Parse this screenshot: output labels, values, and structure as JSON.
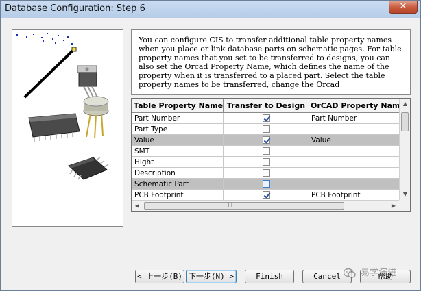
{
  "window": {
    "title": "Database Configuration: Step 6",
    "close_glyph": "✕"
  },
  "description": "You can configure CIS to transfer additional table property names when you place or link database parts on schematic pages. For table property names that you set to be transferred to designs, you can also set the Orcad Property Name, which defines the name of the property when it is transferred to a placed part. Select the table property names to be transferred, change the Orcad",
  "grid": {
    "headers": [
      "Table Property Name",
      "Transfer to Design",
      "OrCAD Property Name"
    ],
    "rows": [
      {
        "name": "Part Number",
        "transfer": true,
        "orcad": "Part Number",
        "shaded": false
      },
      {
        "name": "Part Type",
        "transfer": false,
        "orcad": "",
        "shaded": false
      },
      {
        "name": "Value",
        "transfer": true,
        "orcad": "Value",
        "shaded": true
      },
      {
        "name": "SMT",
        "transfer": false,
        "orcad": "",
        "shaded": false
      },
      {
        "name": "Hight",
        "transfer": false,
        "orcad": "",
        "shaded": false
      },
      {
        "name": "Description",
        "transfer": false,
        "orcad": "",
        "shaded": false
      },
      {
        "name": "Schematic Part",
        "transfer": false,
        "orcad": "",
        "shaded": true,
        "focused": true
      },
      {
        "name": "PCB Footprint",
        "transfer": true,
        "orcad": "PCB Footprint",
        "shaded": false
      }
    ]
  },
  "buttons": {
    "back": "< 上一步(B)",
    "next": "下一步(N) >",
    "finish": "Finish",
    "cancel": "Cancel",
    "help": "帮助"
  },
  "watermark": "易学演进",
  "icons": {
    "close": "close-icon",
    "scroll_up": "scroll-up-arrow-icon",
    "scroll_down": "scroll-down-arrow-icon",
    "scroll_left": "scroll-left-arrow-icon",
    "scroll_right": "scroll-right-arrow-icon",
    "watermark": "wechat-icon"
  }
}
